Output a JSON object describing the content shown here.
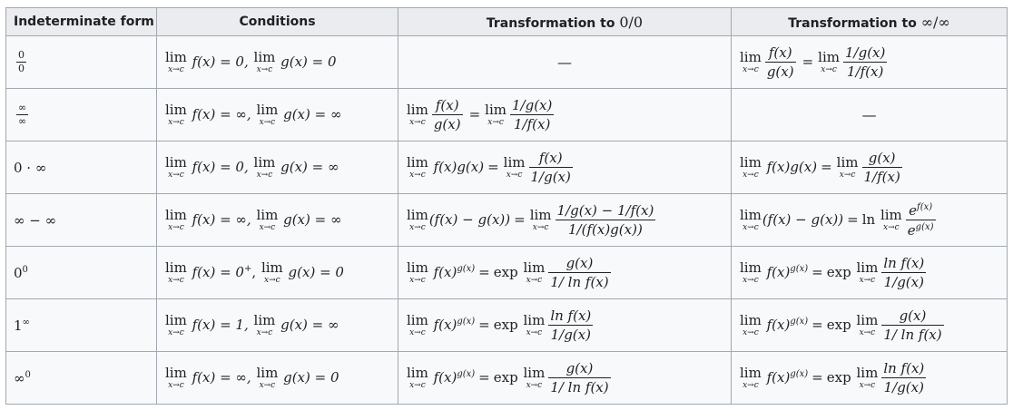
{
  "headers": {
    "form": "Indeterminate form",
    "conditions": "Conditions",
    "to_zero_prefix": "Transformation to ",
    "to_zero_math": "0/0",
    "to_inf_prefix": "Transformation to ",
    "to_inf_math": "∞/∞"
  },
  "sym": {
    "lim": "lim",
    "sub": "x→c",
    "dash": "—",
    "eq": "=",
    "exp": "exp",
    "ln": "ln",
    "fx": "f(x)",
    "gx": "g(x)",
    "one_over_gx": "1/g(x)",
    "one_over_fx": "1/f(x)",
    "one_over_ln_fx": "1/ ln f(x)",
    "ln_fx": "ln f(x)"
  },
  "rows": [
    {
      "form_num": "0",
      "form_den": "0",
      "cond_a": "f(x) = 0,",
      "cond_b": "g(x) = 0"
    },
    {
      "form_num": "∞",
      "form_den": "∞",
      "cond_a": "f(x) = ∞,",
      "cond_b": "g(x) = ∞"
    },
    {
      "form": "0 · ∞",
      "cond_a": "f(x) = 0,",
      "cond_b": "g(x) = ∞",
      "t1_left": "f(x)g(x)",
      "t2_left": "f(x)g(x)"
    },
    {
      "form": "∞ − ∞",
      "cond_a": "f(x) = ∞,",
      "cond_b": "g(x) = ∞",
      "left": "(f(x) − g(x))",
      "t1_num": "1/g(x) − 1/f(x)",
      "t1_den": "1/(f(x)g(x))",
      "t2_num_base": "e",
      "t2_num_sup": "f(x)",
      "t2_den_base": "e",
      "t2_den_sup": "g(x)"
    },
    {
      "form_base": "0",
      "form_sup": "0",
      "cond_a_pre": "f(x) = 0",
      "cond_a_sup": "+",
      "cond_a_post": ",",
      "cond_b": "g(x) = 0",
      "pow_base": "f(x)",
      "pow_sup": "g(x)"
    },
    {
      "form_base": "1",
      "form_sup": "∞",
      "cond_a": "f(x) = 1,",
      "cond_b": "g(x) = ∞",
      "pow_base": "f(x)",
      "pow_sup": "g(x)"
    },
    {
      "form_base": "∞",
      "form_sup": "0",
      "cond_a": "f(x) = ∞,",
      "cond_b": "g(x) = 0",
      "pow_base": "f(x)",
      "pow_sup": "g(x)"
    }
  ]
}
